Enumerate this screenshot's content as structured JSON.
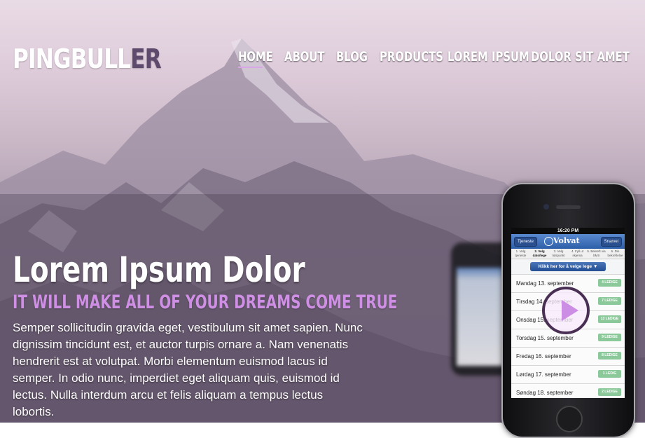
{
  "header": {
    "logo_main": "PINGBULL",
    "logo_accent": "ER",
    "nav": {
      "home": "HOME",
      "about": "ABOUT",
      "blog": "BLOG",
      "products": "PRODUCTS",
      "lorem": "LOREM IPSUM",
      "dolor": "DOLOR SIT AMET"
    }
  },
  "hero": {
    "title": "Lorem Ipsum Dolor",
    "subtitle": "IT WILL MAKE ALL OF YOUR DREAMS COME TRUE",
    "body": "Semper sollicitudin gravida eget, vestibulum sit amet sapien. Nunc dignissim tincidunt est, et auctor turpis ornare a. Nam venenatis hendrerit est at volutpat. Morbi elementum euismod lacus id semper. In odio nunc, imperdiet eget aliquam quis, euismod id lectus. Nulla interdum arcu et felis aliquam a tempus lectus lobortis."
  },
  "phone": {
    "time": "16:20 PM",
    "app_title": "Volvat",
    "back_button": "Tjeneste",
    "forward_button": "Snarvei",
    "steps": [
      "1. Velg tjeneste",
      "2. Velg dato/lege",
      "3. Velg tidspunkt",
      "4. Fyll ut skjema",
      "5. Bekreft via SMS",
      "6. Din bekreftelse"
    ],
    "pick_button": "Klikk her for å velge lege ▼",
    "days": [
      {
        "date": "Mandag 13. september",
        "badge": "4 LEDIGE"
      },
      {
        "date": "Tirsdag 14. september",
        "badge": "7 LEDIGE"
      },
      {
        "date": "Onsdag 15. september",
        "badge": "13 LEDIGE"
      },
      {
        "date": "Torsdag 15. september",
        "badge": "9 LEDIGE"
      },
      {
        "date": "Fredag 16. september",
        "badge": "8 LEDIGE"
      },
      {
        "date": "Lørdag 17. september",
        "badge": "1 LEDIG"
      },
      {
        "date": "Søndag 18. september",
        "badge": "2 LEDIGE"
      }
    ]
  },
  "colors": {
    "accent": "#cf8fe4",
    "logo_accent": "#5e4a6c",
    "badge": "#8bc99a"
  },
  "icons": {
    "play": "play-icon"
  }
}
